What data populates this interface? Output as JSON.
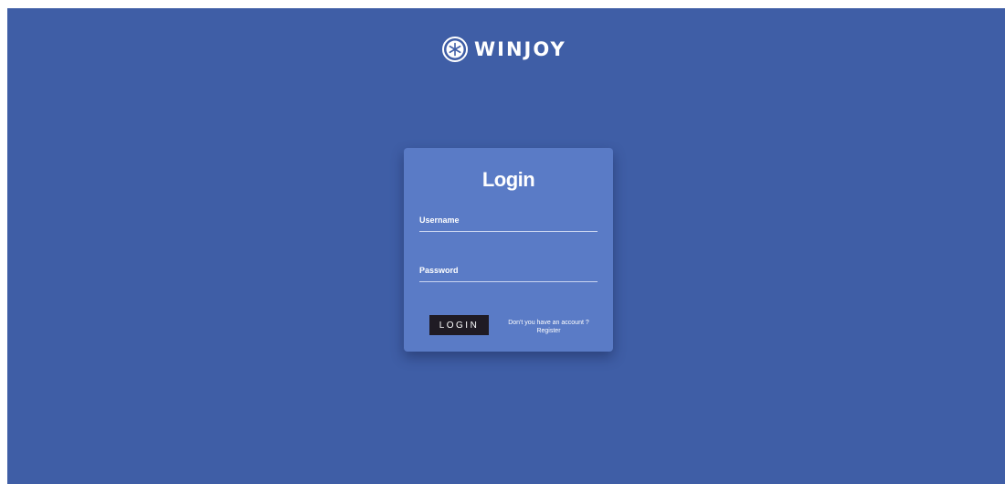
{
  "brand": {
    "name": "WINJOY",
    "icon": "snowflake-icon"
  },
  "login": {
    "title": "Login",
    "username_label": "Username",
    "password_label": "Password",
    "login_button": "LOGIN",
    "no_account_prompt": "Don't you have an account ?",
    "register_link": "Register"
  },
  "colors": {
    "background": "#3f5ea6",
    "card": "#5a7bc6",
    "button": "#1f1b24",
    "text": "#ffffff"
  }
}
